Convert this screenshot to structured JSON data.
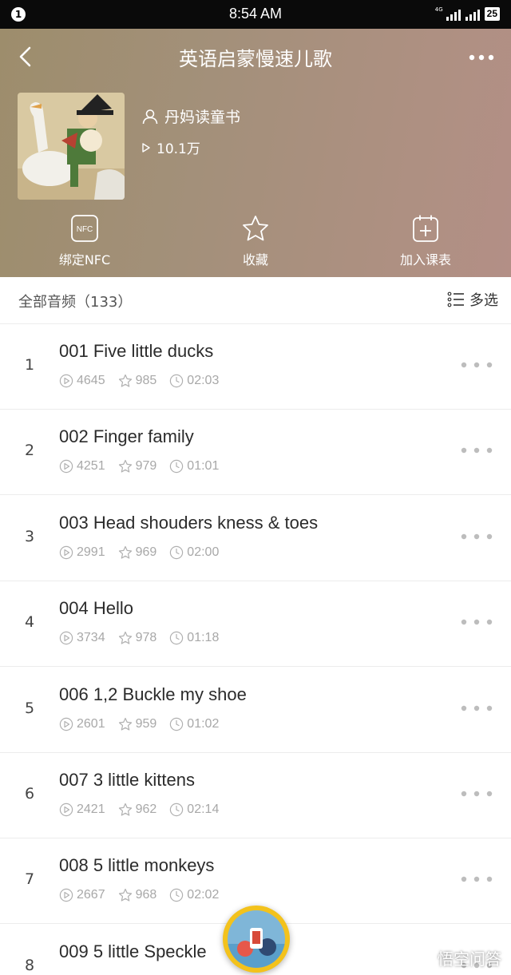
{
  "status_bar": {
    "notification_count": "1",
    "time": "8:54 AM",
    "network": "4G",
    "battery": "25"
  },
  "header": {
    "title": "英语启蒙慢速儿歌",
    "author": "丹妈读童书",
    "plays": "10.1万",
    "actions": [
      {
        "label": "绑定NFC",
        "icon": "nfc-icon",
        "icon_text": "NFC"
      },
      {
        "label": "收藏",
        "icon": "star-icon"
      },
      {
        "label": "加入课表",
        "icon": "calendar-add-icon"
      }
    ]
  },
  "list": {
    "count_label": "全部音频（133）",
    "multi_select_label": "多选",
    "tracks": [
      {
        "index": "1",
        "title": "001 Five  little ducks",
        "plays": "4645",
        "favorites": "985",
        "duration": "02:03"
      },
      {
        "index": "2",
        "title": "002 Finger family",
        "plays": "4251",
        "favorites": "979",
        "duration": "01:01"
      },
      {
        "index": "3",
        "title": "003 Head shouders kness & toes",
        "plays": "2991",
        "favorites": "969",
        "duration": "02:00"
      },
      {
        "index": "4",
        "title": "004 Hello",
        "plays": "3734",
        "favorites": "978",
        "duration": "01:18"
      },
      {
        "index": "5",
        "title": "006 1,2 Buckle my shoe",
        "plays": "2601",
        "favorites": "959",
        "duration": "01:02"
      },
      {
        "index": "6",
        "title": "007 3 little kittens",
        "plays": "2421",
        "favorites": "962",
        "duration": "02:14"
      },
      {
        "index": "7",
        "title": "008 5 little monkeys",
        "plays": "2667",
        "favorites": "968",
        "duration": "02:02"
      },
      {
        "index": "8",
        "title": "009 5 little Speckle",
        "plays": "",
        "favorites": "",
        "duration": ""
      }
    ]
  },
  "watermark": "悟空问答",
  "colors": {
    "header_gradient_start": "#9d8d6c",
    "header_gradient_end": "#b38f86",
    "player_ring": "#f3c21c"
  }
}
